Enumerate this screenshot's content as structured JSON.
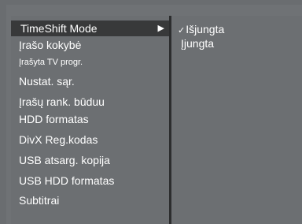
{
  "menu": {
    "selected_label": "TimeShift Mode",
    "selected_arrow": "▶",
    "items": [
      "Įrašo kokybė",
      "Įrašyta TV progr.",
      "Nustat. sąr.",
      "Įrašų rank. būduu",
      "HDD formatas",
      "DivX Reg.kodas",
      "USB atsarg. kopija",
      "USB HDD formatas",
      "Subtitrai"
    ]
  },
  "submenu": {
    "options": [
      {
        "check": "✓",
        "label": "Išjungta"
      },
      {
        "check": "",
        "label": "Įjungta"
      }
    ]
  },
  "colors": {
    "panel": "#6c6f72",
    "highlight": "#38393a",
    "divider": "#2c2d2e",
    "text": "#ffffff"
  }
}
